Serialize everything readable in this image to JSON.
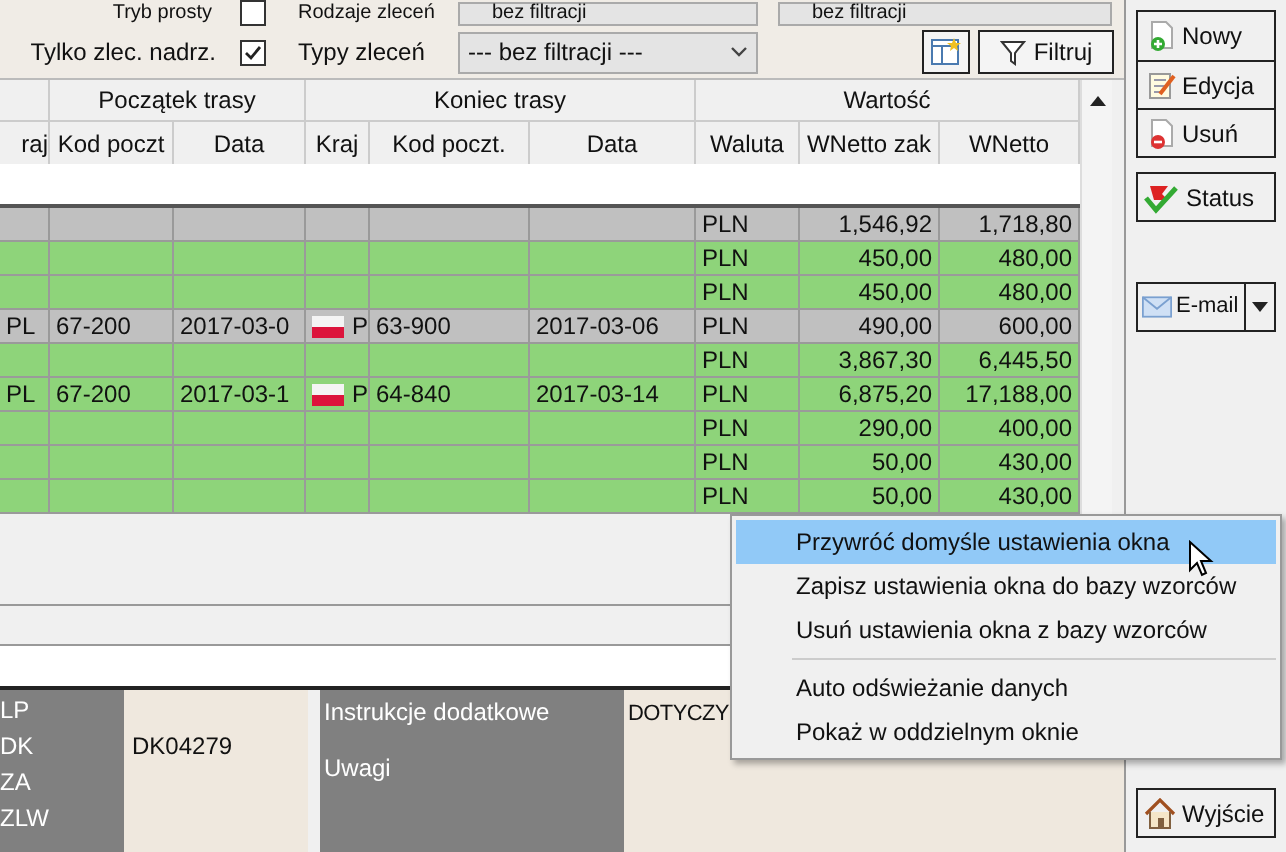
{
  "filter_rows": [
    {
      "check_label": "Tryb prosty",
      "checked": false,
      "select_label": "Rodzaje zleceń",
      "select_value": "bez filtracji",
      "extra_select_value": "bez filtracji"
    },
    {
      "check_label": "Tylko zlec. nadrz.",
      "checked": true,
      "select_label": "Typy zleceń",
      "select_value": "--- bez filtracji ---"
    }
  ],
  "filter_button": "Filtruj",
  "table": {
    "column_groups": [
      {
        "columns": [
          "raj"
        ]
      },
      {
        "label": "Początek trasy",
        "columns": [
          "Kod poczt",
          "Data"
        ]
      },
      {
        "label": "Koniec trasy",
        "columns": [
          "Kraj",
          "Kod poczt.",
          "Data"
        ]
      },
      {
        "label": "Wartość",
        "columns": [
          "Waluta",
          "WNetto zak",
          "WNetto"
        ]
      }
    ],
    "rows": [
      {
        "color": "#c0c0c0",
        "flag": false,
        "waluta": "PLN",
        "wnetto_zak": "1,546,92",
        "wnetto": "1,718,80"
      },
      {
        "color": "#8ed47a",
        "flag": false,
        "waluta": "PLN",
        "wnetto_zak": "450,00",
        "wnetto": "480,00"
      },
      {
        "color": "#8ed47a",
        "flag": false,
        "waluta": "PLN",
        "wnetto_zak": "450,00",
        "wnetto": "480,00"
      },
      {
        "color": "#c0c0c0",
        "flag": true,
        "kraj_start": "PL",
        "kod_start": "67-200",
        "data_start": "2017-03-0",
        "kraj_end": "P",
        "kod_end": "63-900",
        "data_end": "2017-03-06",
        "waluta": "PLN",
        "wnetto_zak": "490,00",
        "wnetto": "600,00"
      },
      {
        "color": "#8ed47a",
        "flag": false,
        "waluta": "PLN",
        "wnetto_zak": "3,867,30",
        "wnetto": "6,445,50"
      },
      {
        "color": "#8ed47a",
        "flag": true,
        "kraj_start": "PL",
        "kod_start": "67-200",
        "data_start": "2017-03-1",
        "kraj_end": "P",
        "kod_end": "64-840",
        "data_end": "2017-03-14",
        "waluta": "PLN",
        "wnetto_zak": "6,875,20",
        "wnetto": "17,188,00"
      },
      {
        "color": "#8ed47a",
        "flag": false,
        "waluta": "PLN",
        "wnetto_zak": "290,00",
        "wnetto": "400,00"
      },
      {
        "color": "#8ed47a",
        "flag": false,
        "waluta": "PLN",
        "wnetto_zak": "50,00",
        "wnetto": "430,00"
      },
      {
        "color": "#8ed47a",
        "flag": false,
        "waluta": "PLN",
        "wnetto_zak": "50,00",
        "wnetto": "430,00"
      }
    ]
  },
  "details": {
    "labels": [
      "LP",
      "DK",
      "ZA",
      "ZLW"
    ],
    "dk_value": "DK04279",
    "notes_labels": [
      "Instrukcje dodatkowe",
      "Uwagi"
    ],
    "dotyczy": "DOTYCZY"
  },
  "sidebar": {
    "record_buttons": [
      "Nowy",
      "Edycja",
      "Usuń"
    ],
    "status_button": "Status",
    "email_button": "E-mail",
    "exit_button": "Wyjście"
  },
  "context_menu": {
    "items": [
      {
        "label": "Przywróć domyśle ustawienia okna",
        "selected": true,
        "separator_before": false
      },
      {
        "label": "Zapisz ustawienia okna do bazy wzorców",
        "selected": false,
        "separator_before": false
      },
      {
        "label": "Usuń ustawienia okna z bazy wzorców",
        "selected": false,
        "separator_before": false
      },
      {
        "label": "Auto odświeżanie danych",
        "selected": false,
        "separator_before": true
      },
      {
        "label": "Pokaż w oddzielnym oknie",
        "selected": false,
        "separator_before": false
      }
    ]
  }
}
